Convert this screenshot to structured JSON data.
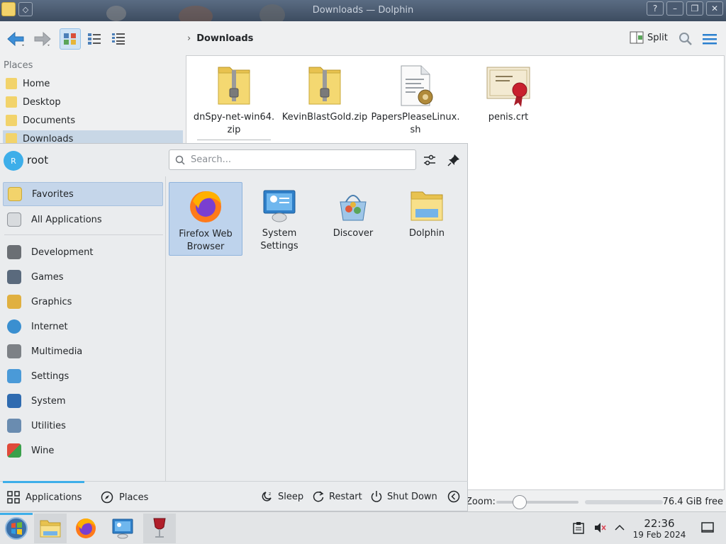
{
  "window": {
    "title": "Downloads — Dolphin",
    "help_glyph": "?",
    "minimize_glyph": "–",
    "maximize_glyph": "❐",
    "close_glyph": "✕"
  },
  "toolbar": {
    "breadcrumb": "Downloads",
    "split_label": "Split"
  },
  "places": {
    "title": "Places",
    "items": [
      {
        "label": "Home",
        "icon": "home-folder-icon"
      },
      {
        "label": "Desktop",
        "icon": "desktop-folder-icon"
      },
      {
        "label": "Documents",
        "icon": "documents-folder-icon"
      },
      {
        "label": "Downloads",
        "icon": "downloads-folder-icon",
        "active": true
      }
    ]
  },
  "files": [
    {
      "name_line1": "dnSpy-net-win64.",
      "name_line2": "zip",
      "icon": "zip-archive-icon"
    },
    {
      "name_line1": "KevinBlastGold.zip",
      "name_line2": "",
      "icon": "zip-archive-icon"
    },
    {
      "name_line1": "PapersPleaseLinux.",
      "name_line2": "sh",
      "icon": "shell-script-icon"
    },
    {
      "name_line1": "penis.crt",
      "name_line2": "",
      "icon": "certificate-icon"
    }
  ],
  "statusbar": {
    "zoom_label": "Zoom:",
    "zoom_level": 0.2,
    "free_space": "76.4 GiB free"
  },
  "launcher": {
    "avatar_letter": "R",
    "username": "root",
    "search_placeholder": "Search...",
    "categories_top": [
      {
        "label": "Favorites",
        "icon": "favorites-icon",
        "active": true
      },
      {
        "label": "All Applications",
        "icon": "all-applications-icon"
      }
    ],
    "categories": [
      {
        "label": "Development",
        "icon": "development-icon"
      },
      {
        "label": "Games",
        "icon": "games-icon"
      },
      {
        "label": "Graphics",
        "icon": "graphics-icon"
      },
      {
        "label": "Internet",
        "icon": "internet-icon"
      },
      {
        "label": "Multimedia",
        "icon": "multimedia-icon"
      },
      {
        "label": "Settings",
        "icon": "settings-icon"
      },
      {
        "label": "System",
        "icon": "system-icon"
      },
      {
        "label": "Utilities",
        "icon": "utilities-icon"
      },
      {
        "label": "Wine",
        "icon": "wine-icon"
      }
    ],
    "apps": [
      {
        "line1": "Firefox Web",
        "line2": "Browser",
        "icon": "firefox-icon",
        "active": true
      },
      {
        "line1": "System",
        "line2": "Settings",
        "icon": "system-settings-icon"
      },
      {
        "line1": "Discover",
        "line2": "",
        "icon": "discover-icon"
      },
      {
        "line1": "Dolphin",
        "line2": "",
        "icon": "dolphin-icon"
      }
    ],
    "footer": {
      "applications_tab": "Applications",
      "places_tab": "Places",
      "sleep": "Sleep",
      "restart": "Restart",
      "shutdown": "Shut Down"
    }
  },
  "taskbar": {
    "time": "22:36",
    "date": "19 Feb 2024"
  },
  "colors": {
    "accent": "#3daee9",
    "selection": "#c5d6ea",
    "folder": "#f2d36b"
  }
}
